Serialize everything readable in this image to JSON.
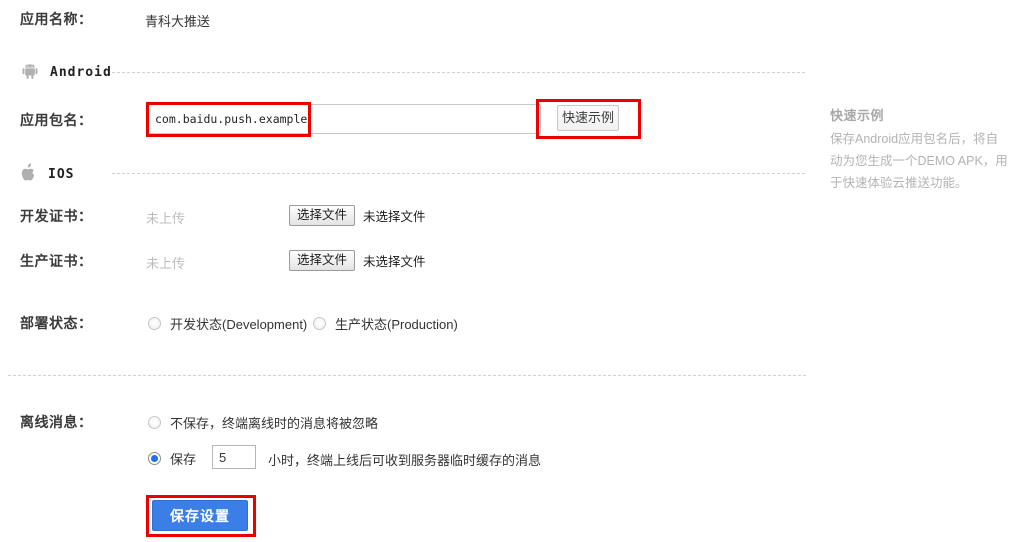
{
  "form": {
    "app_name": {
      "label": "应用名称：",
      "value": "青科大推送"
    },
    "android_section": {
      "platform_label": "Android",
      "icon": "android-icon",
      "package_name": {
        "label": "应用包名：",
        "value": "com.baidu.push.example",
        "placeholder": "",
        "example_button": "快速示例"
      }
    },
    "ios_section": {
      "platform_label": "IOS",
      "icon": "apple-icon",
      "dev_cert": {
        "label": "开发证书：",
        "status": "未上传",
        "choose_button": "选择文件",
        "file_status": "未选择文件"
      },
      "prod_cert": {
        "label": "生产证书：",
        "status": "未上传",
        "choose_button": "选择文件",
        "file_status": "未选择文件"
      },
      "deploy_status": {
        "label": "部署状态：",
        "options": [
          {
            "label": "开发状态(Development)",
            "checked": false
          },
          {
            "label": "生产状态(Production)",
            "checked": false
          }
        ]
      }
    },
    "offline_message": {
      "label": "离线消息：",
      "option_discard": {
        "label": "不保存，终端离线时的消息将被忽略",
        "checked": false
      },
      "option_keep": {
        "prefix": "保存",
        "hours_value": "5",
        "suffix": "小时，终端上线后可收到服务器临时缓存的消息",
        "checked": true
      }
    },
    "submit_button": "保存设置"
  },
  "help_panel": {
    "title": "快速示例",
    "body": "保存Android应用包名后，将自动为您生成一个DEMO APK，用于快速体验云推送功能。"
  },
  "colors": {
    "accent": "#3c7ee8",
    "highlight": "#ee0000",
    "muted_text": "#b3b3b3",
    "border": "#c7c7c7"
  }
}
